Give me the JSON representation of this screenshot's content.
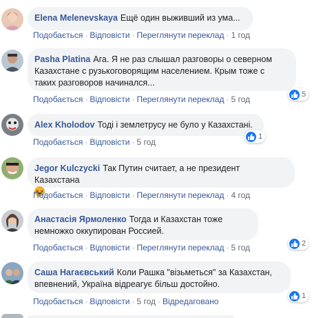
{
  "labels": {
    "like": "Подобається",
    "reply": "Відповісти",
    "translate": "Переглянути переклад",
    "edited": "Відредаговано"
  },
  "comments": [
    {
      "author": "Elena Melenevskaya",
      "text": "Ещё один выживший из ума...",
      "time": "1 год",
      "reactions": null
    },
    {
      "author": "Pasha Platina",
      "text": "Ага. Я не раз слышал разговоры о северном Казахстане с рузькоговорящим населением. Крым тоже с таких разговоров начинался...",
      "time": "5 год",
      "reactions": "5"
    },
    {
      "author": "Alex Kholodov",
      "text": "Тоді і землетрусу не було у Казахстані.",
      "time": "5 год",
      "reactions": "1"
    },
    {
      "author": "Jegor Kulczycki",
      "text": "Так Путин считает, а не президент Казахстана",
      "time": "4 год",
      "reactions": null
    },
    {
      "author": "Анастасія Ярмоленко",
      "text": "Тогда и Казахстан тоже немножко оккупирован Россией.",
      "time": "5 год",
      "reactions": "2"
    },
    {
      "author": "Саша Нагаєвський",
      "text": "Коли Рашка \"візьметься\" за Казахстан, впевнений, Україна відреагує більш достойно.",
      "time": "5 год",
      "reactions": "1"
    }
  ],
  "colors": {
    "link": "#385898",
    "bubble": "#f2f3f5",
    "like_blue": "#1877f2"
  }
}
